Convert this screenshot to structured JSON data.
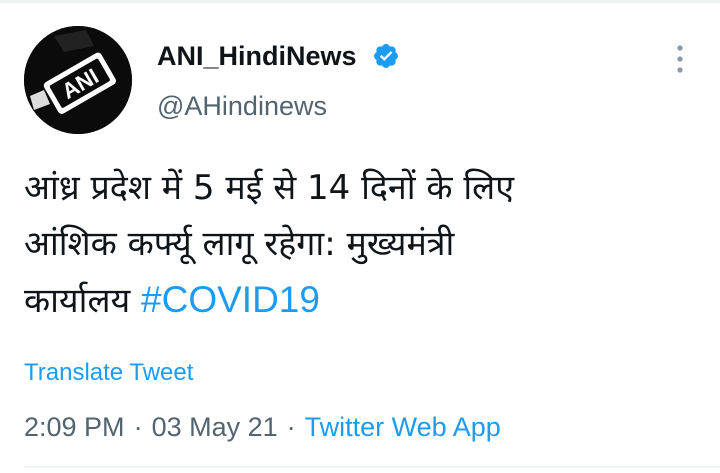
{
  "tweet": {
    "author": {
      "display_name": "ANI_HindiNews",
      "handle": "@AHindinews",
      "verified": true,
      "avatar_text": "ANI"
    },
    "text_lines": [
      "आंध्र प्रदेश में 5 मई से 14 दिनों के लिए",
      "आंशिक कर्फ्यू लागू रहेगा: मुख्यमंत्री",
      "कार्यालय"
    ],
    "hashtag": "#COVID19",
    "translate_label": "Translate Tweet",
    "time": "2:09 PM",
    "separator": "·",
    "date": "03 May 21",
    "source": "Twitter Web App"
  },
  "colors": {
    "accent": "#1d9bf0",
    "text_primary": "#0f1419",
    "text_secondary": "#536471",
    "divider": "#eff3f4"
  },
  "icons": {
    "verified": "verified-badge-icon",
    "more": "more-options-icon"
  }
}
